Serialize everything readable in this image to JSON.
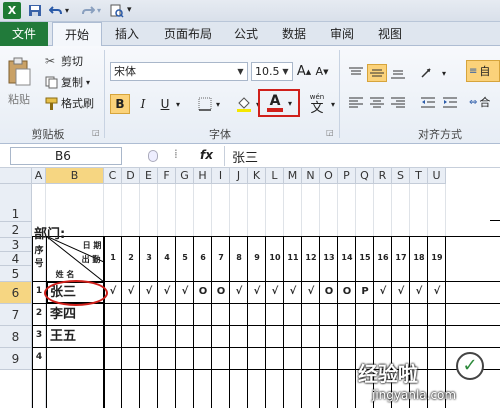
{
  "ribbon_tabs": [
    {
      "label": "文件"
    },
    {
      "label": "开始"
    },
    {
      "label": "插入"
    },
    {
      "label": "页面布局"
    },
    {
      "label": "公式"
    },
    {
      "label": "数据"
    },
    {
      "label": "审阅"
    },
    {
      "label": "视图"
    }
  ],
  "clipboard": {
    "paste_label": "粘贴",
    "cut_label": "剪切",
    "copy_label": "复制",
    "format_painter_label": "格式刷",
    "group_label": "剪贴板"
  },
  "font": {
    "name": "宋体",
    "size": "10.5",
    "group_label": "字体",
    "bold": "B",
    "italic": "I",
    "underline": "U",
    "font_color_letter": "A",
    "phonetic_top": "wén",
    "phonetic_char": "文",
    "grow": "A",
    "shrink": "A"
  },
  "alignment": {
    "group_label": "对齐方式",
    "wrap_label": "自",
    "merge_label": "合"
  },
  "formula_bar": {
    "name_box": "B6",
    "fx": "fx",
    "value": "张三"
  },
  "columns": [
    "A",
    "B",
    "C",
    "D",
    "E",
    "F",
    "G",
    "H",
    "I",
    "J",
    "K",
    "L",
    "M",
    "N",
    "O",
    "P",
    "Q",
    "R",
    "S",
    "T",
    "U"
  ],
  "rows": [
    "1",
    "2",
    "3",
    "4",
    "5",
    "6",
    "7",
    "8",
    "9"
  ],
  "sheet": {
    "dept_label": "部门:",
    "seq_header_1": "序",
    "seq_header_2": "号",
    "diag_date": "日 期",
    "diag_attend": "出 勤",
    "diag_name": "姓 名",
    "days": [
      "1",
      "2",
      "3",
      "4",
      "5",
      "6",
      "7",
      "8",
      "9",
      "10",
      "11",
      "12",
      "13",
      "14",
      "15",
      "16",
      "17",
      "18",
      "19"
    ],
    "people": [
      {
        "seq": "1",
        "name": "张三",
        "marks": [
          "√",
          "√",
          "√",
          "√",
          "√",
          "O",
          "O",
          "√",
          "√",
          "√",
          "√",
          "√",
          "O",
          "O",
          "P",
          "√",
          "√",
          "√",
          "√"
        ]
      },
      {
        "seq": "2",
        "name": "李四"
      },
      {
        "seq": "3",
        "name": "王五"
      },
      {
        "seq": "4",
        "name": ""
      }
    ]
  },
  "watermark": {
    "text": "经验啦",
    "check": "✓",
    "url": "jingyanla.com"
  },
  "colors": {
    "file_tab": "#217a3a",
    "selected_header": "#f6d682",
    "highlight_box": "#d0201b"
  }
}
